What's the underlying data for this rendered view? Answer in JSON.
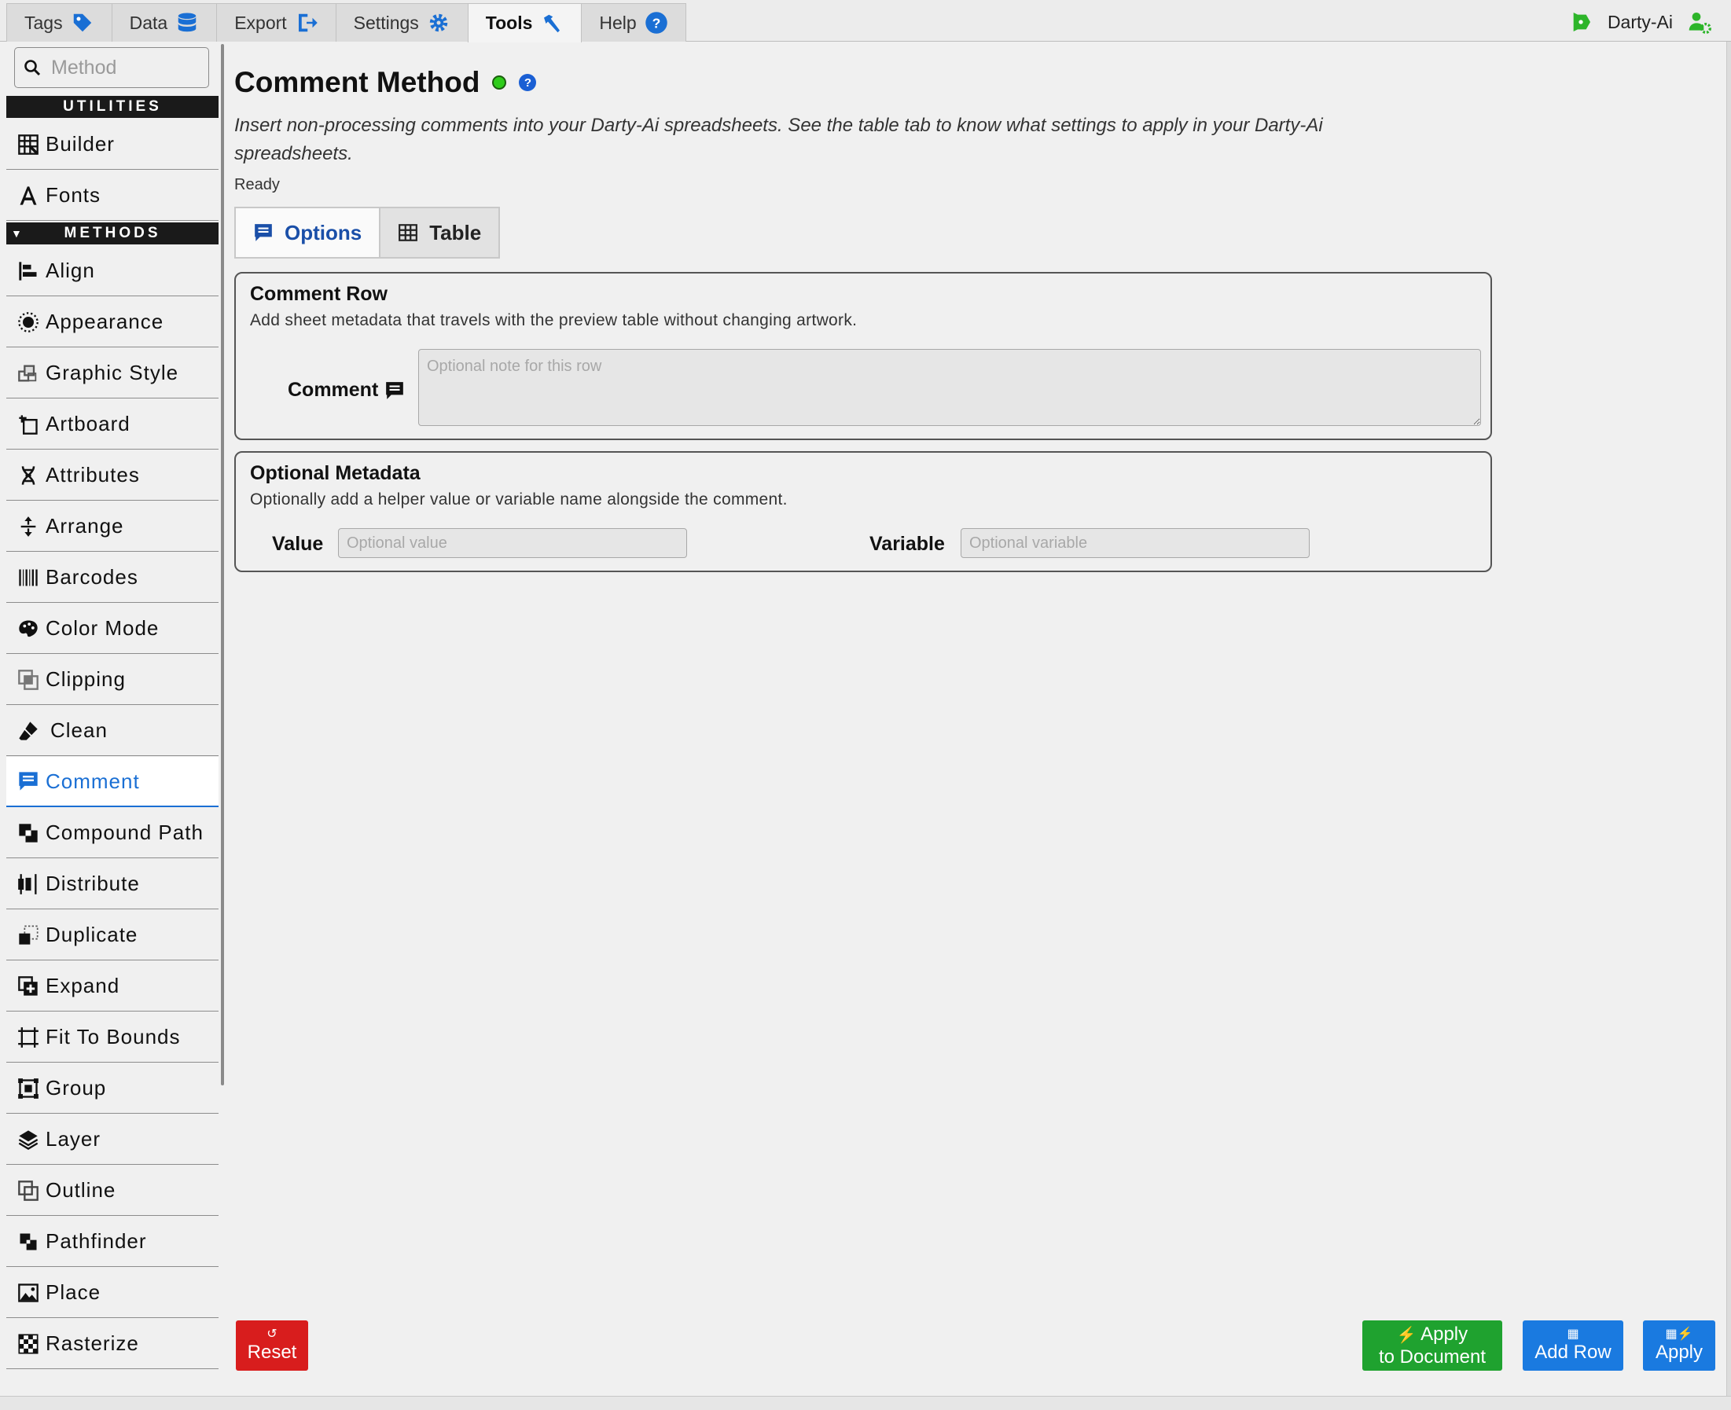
{
  "top_tabs": [
    {
      "label": "Tags",
      "icon": "tag-icon"
    },
    {
      "label": "Data",
      "icon": "database-icon"
    },
    {
      "label": "Export",
      "icon": "export-icon"
    },
    {
      "label": "Settings",
      "icon": "gear-icon"
    },
    {
      "label": "Tools",
      "icon": "hammer-icon",
      "active": true
    },
    {
      "label": "Help",
      "icon": "help-icon"
    }
  ],
  "user": {
    "name": "Darty-Ai"
  },
  "sidebar": {
    "search_placeholder": "Method",
    "utilities_header": "UTILITIES",
    "methods_header": "METHODS",
    "utilities": [
      {
        "label": "Builder",
        "icon": "grid-icon"
      },
      {
        "label": "Fonts",
        "icon": "font-icon"
      }
    ],
    "methods": [
      {
        "label": "Align",
        "icon": "align-icon"
      },
      {
        "label": "Appearance",
        "icon": "sun-icon"
      },
      {
        "label": "Graphic Style",
        "icon": "style-icon"
      },
      {
        "label": "Artboard",
        "icon": "artboard-icon"
      },
      {
        "label": "Attributes",
        "icon": "dna-icon"
      },
      {
        "label": "Arrange",
        "icon": "arrange-icon"
      },
      {
        "label": "Barcodes",
        "icon": "barcode-icon"
      },
      {
        "label": "Color Mode",
        "icon": "palette-icon"
      },
      {
        "label": "Clipping",
        "icon": "clipping-icon"
      },
      {
        "label": "Clean",
        "icon": "eraser-icon"
      },
      {
        "label": "Comment",
        "icon": "comment-icon",
        "active": true
      },
      {
        "label": "Compound Path",
        "icon": "compound-path-icon"
      },
      {
        "label": "Distribute",
        "icon": "distribute-icon"
      },
      {
        "label": "Duplicate",
        "icon": "duplicate-icon"
      },
      {
        "label": "Expand",
        "icon": "expand-icon"
      },
      {
        "label": "Fit To Bounds",
        "icon": "fit-bounds-icon"
      },
      {
        "label": "Group",
        "icon": "group-icon"
      },
      {
        "label": "Layer",
        "icon": "layers-icon"
      },
      {
        "label": "Outline",
        "icon": "outline-icon"
      },
      {
        "label": "Pathfinder",
        "icon": "pathfinder-icon"
      },
      {
        "label": "Place",
        "icon": "image-icon"
      },
      {
        "label": "Rasterize",
        "icon": "checker-icon"
      }
    ]
  },
  "main": {
    "title": "Comment Method",
    "description": "Insert non-processing comments into your Darty-Ai spreadsheets. See the table tab to know what settings to apply in your Darty-Ai spreadsheets.",
    "status": "Ready",
    "tabs": [
      {
        "label": "Options",
        "active": true
      },
      {
        "label": "Table"
      }
    ],
    "comment_row": {
      "title": "Comment Row",
      "subtitle": "Add sheet metadata that travels with the preview table without changing artwork.",
      "comment_label": "Comment",
      "comment_placeholder": "Optional note for this row",
      "comment_value": ""
    },
    "optional_metadata": {
      "title": "Optional Metadata",
      "subtitle": "Optionally add a helper value or variable name alongside the comment.",
      "value_label": "Value",
      "value_placeholder": "Optional value",
      "value_value": "",
      "variable_label": "Variable",
      "variable_placeholder": "Optional variable",
      "variable_value": ""
    }
  },
  "buttons": {
    "reset": "Reset",
    "apply_doc_line1": "Apply",
    "apply_doc_line2": "to Document",
    "add_row": "Add Row",
    "apply": "Apply"
  },
  "colors": {
    "accent_blue": "#1a7ae0",
    "active_text": "#1a6fd4",
    "reset_red": "#d81d1d",
    "apply_green": "#1fa22f",
    "status_green": "#2ecc1a",
    "user_green": "#2db52a"
  }
}
